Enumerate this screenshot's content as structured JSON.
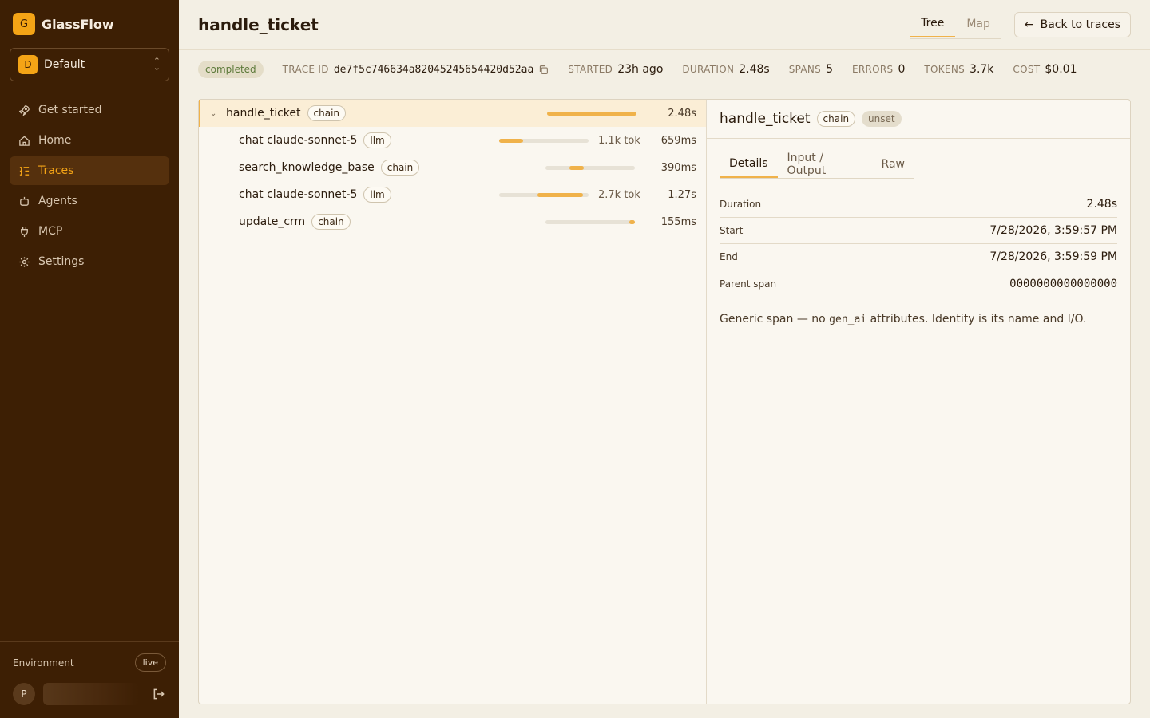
{
  "brand": {
    "logo": "G",
    "name": "GlassFlow"
  },
  "workspace": {
    "avatar": "D",
    "name": "Default"
  },
  "nav": [
    {
      "label": "Get started",
      "icon": "rocket-icon"
    },
    {
      "label": "Home",
      "icon": "home-icon"
    },
    {
      "label": "Traces",
      "icon": "traces-icon",
      "active": true
    },
    {
      "label": "Agents",
      "icon": "robot-icon"
    },
    {
      "label": "MCP",
      "icon": "plug-icon"
    },
    {
      "label": "Settings",
      "icon": "gear-icon"
    }
  ],
  "footer": {
    "env_label": "Environment",
    "env_badge": "live",
    "user_initial": "P"
  },
  "header": {
    "title": "handle_ticket",
    "tabs": [
      "Tree",
      "Map"
    ],
    "back_label": "Back to traces"
  },
  "meta": {
    "status": "completed",
    "trace_id_label": "TRACE ID",
    "trace_id": "de7f5c746634a82045245654420d52aa",
    "started_label": "STARTED",
    "started": "23h ago",
    "duration_label": "DURATION",
    "duration": "2.48s",
    "spans_label": "SPANS",
    "spans": "5",
    "errors_label": "ERRORS",
    "errors": "0",
    "tokens_label": "TOKENS",
    "tokens": "3.7k",
    "cost_label": "COST",
    "cost": "$0.01"
  },
  "spans": [
    {
      "name": "handle_ticket",
      "tag": "chain",
      "tokens": "",
      "duration": "2.48s",
      "start_frac": 0.0,
      "dur_frac": 1.0,
      "root": true
    },
    {
      "name": "chat claude-sonnet-5",
      "tag": "llm",
      "tokens": "1.1k tok",
      "duration": "659ms",
      "start_frac": 0.0,
      "dur_frac": 0.266
    },
    {
      "name": "search_knowledge_base",
      "tag": "chain",
      "tokens": "",
      "duration": "390ms",
      "start_frac": 0.27,
      "dur_frac": 0.157
    },
    {
      "name": "chat claude-sonnet-5",
      "tag": "llm",
      "tokens": "2.7k tok",
      "duration": "1.27s",
      "start_frac": 0.43,
      "dur_frac": 0.512
    },
    {
      "name": "update_crm",
      "tag": "chain",
      "tokens": "",
      "duration": "155ms",
      "start_frac": 0.94,
      "dur_frac": 0.06
    }
  ],
  "detail": {
    "title": "handle_ticket",
    "tag": "chain",
    "status": "unset",
    "tabs": [
      "Details",
      "Input / Output",
      "Raw"
    ],
    "fields": [
      {
        "key": "Duration",
        "value": "2.48s"
      },
      {
        "key": "Start",
        "value": "7/28/2026, 3:59:57 PM"
      },
      {
        "key": "End",
        "value": "7/28/2026, 3:59:59 PM"
      },
      {
        "key": "Parent span",
        "value": "0000000000000000"
      }
    ],
    "note_before": "Generic span — no ",
    "note_code": "gen_ai",
    "note_after": " attributes. Identity is its name and I/O."
  },
  "colors": {
    "accent": "#f0b24a",
    "sidebar": "#3d1f04",
    "brand": "#f4a416"
  }
}
